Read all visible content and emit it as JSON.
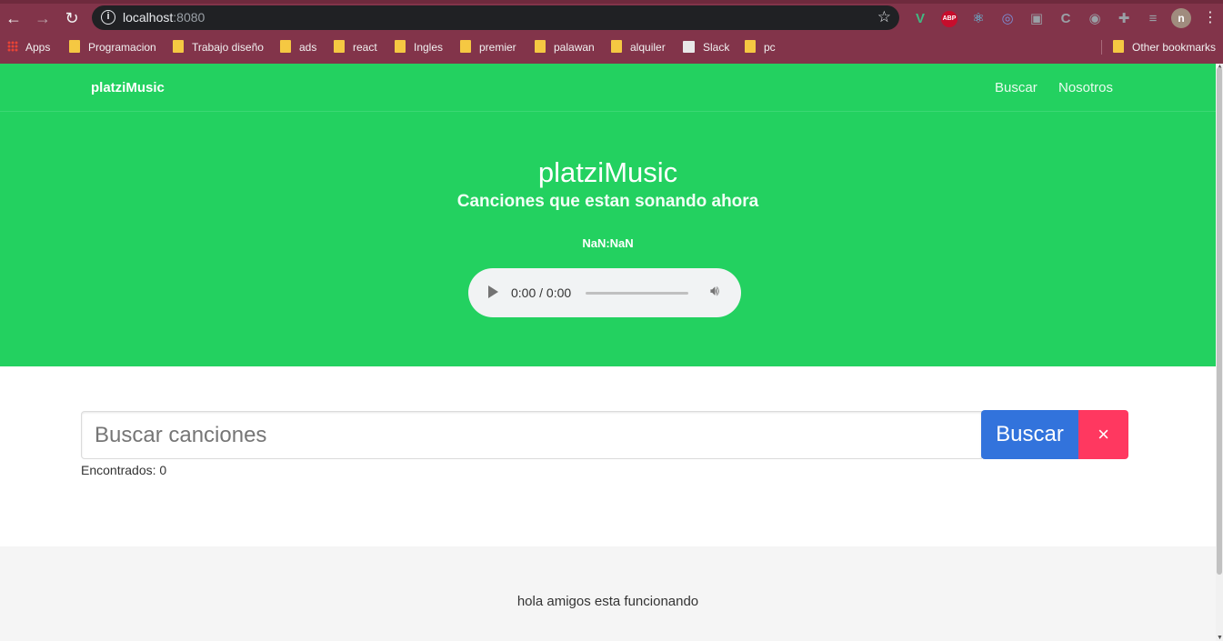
{
  "browser": {
    "url_host": "localhost",
    "url_port": ":8080",
    "back_icon": "←",
    "forward_icon": "→",
    "reload_icon": "↻",
    "star_icon": "☆",
    "extensions": [
      {
        "name": "vue-devtools-icon",
        "glyph": "V",
        "color": "#42b883"
      },
      {
        "name": "adblock-plus-icon",
        "glyph": "ABP",
        "color": "#c70d2c"
      },
      {
        "name": "react-devtools-icon",
        "glyph": "⚛",
        "color": "#61dafb"
      },
      {
        "name": "extension-circle-icon",
        "glyph": "◎",
        "color": "#7c8fd6"
      },
      {
        "name": "screenshot-icon",
        "glyph": "▣",
        "color": "#9aa0a6"
      },
      {
        "name": "c-extension-icon",
        "glyph": "C",
        "color": "#9aa0a6"
      },
      {
        "name": "record-icon",
        "glyph": "◉",
        "color": "#9aa0a6"
      },
      {
        "name": "puzzle-icon",
        "glyph": "✚",
        "color": "#9aa0a6"
      },
      {
        "name": "media-queue-icon",
        "glyph": "≡",
        "color": "#9aa0a6"
      }
    ],
    "profile_initial": "n",
    "menu_icon": "⋮",
    "bookmarks": [
      "Apps",
      "Programacion",
      "Trabajo diseño",
      "ads",
      "react",
      "Ingles",
      "premier",
      "palawan",
      "alquiler",
      "Slack",
      "pc"
    ],
    "other_bookmarks": "Other bookmarks"
  },
  "navbar": {
    "brand": "platziMusic",
    "links": [
      "Buscar",
      "Nosotros"
    ]
  },
  "hero": {
    "title": "platziMusic",
    "subtitle": "Canciones que estan sonando ahora",
    "timer": "NaN:NaN",
    "player_time": "0:00 / 0:00"
  },
  "search": {
    "placeholder": "Buscar canciones",
    "button_label": "Buscar",
    "clear_label": "×",
    "found_label": "Encontrados: 0"
  },
  "footer": {
    "text": "hola amigos esta funcionando"
  },
  "colors": {
    "primary": "#23d160",
    "info": "#3273dc",
    "danger": "#ff3860",
    "browser_chrome": "#82344a"
  }
}
